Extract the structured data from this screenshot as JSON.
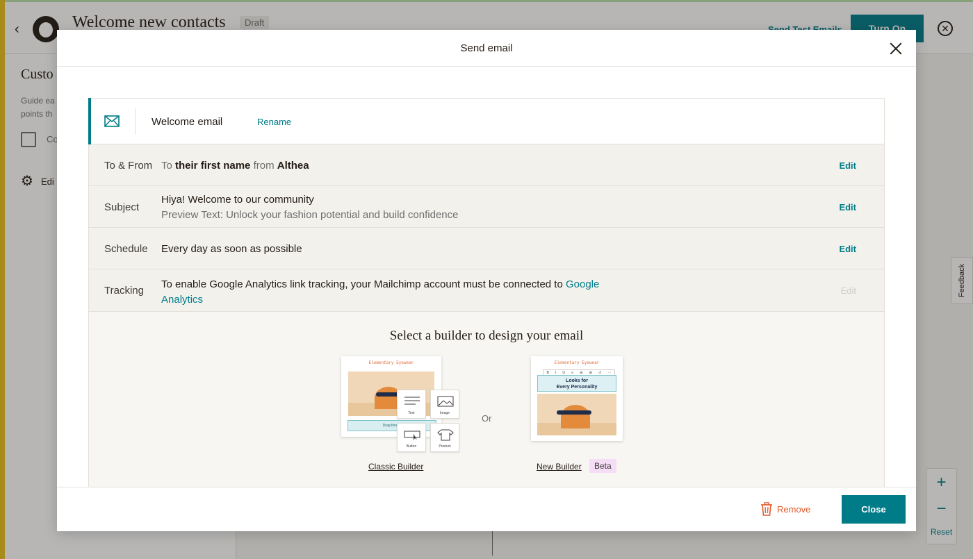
{
  "background": {
    "title": "Welcome new contacts",
    "status_badge": "Draft",
    "send_test_label": "Send Test Emails",
    "turn_on_label": "Turn On",
    "sidebar_title": "Custo",
    "sidebar_desc_1": "Guide ea",
    "sidebar_desc_2": "points th",
    "sidebar_check_label": "Co",
    "sidebar_edit_label": "Edi",
    "feedback_label": "Feedback",
    "zoom_plus": "+",
    "zoom_minus": "−",
    "zoom_reset": "Reset"
  },
  "modal": {
    "title": "Send email",
    "email_name": "Welcome email",
    "rename_label": "Rename",
    "rows": {
      "to_from": {
        "label": "To & From",
        "to_prefix": "To",
        "to_value": "their first name",
        "from_prefix": "from",
        "from_value": "Althea",
        "edit_label": "Edit"
      },
      "subject": {
        "label": "Subject",
        "value": "Hiya! Welcome to our community",
        "preview_text": "Preview Text: Unlock your fashion potential and build confidence",
        "edit_label": "Edit"
      },
      "schedule": {
        "label": "Schedule",
        "value": "Every day as soon as possible",
        "edit_label": "Edit"
      },
      "tracking": {
        "label": "Tracking",
        "text": "To enable Google Analytics link tracking, your Mailchimp account must be connected to",
        "link_line1": "Google",
        "link_line2": "Analytics",
        "edit_label": "Edit"
      }
    },
    "builder": {
      "title": "Select a builder to design your email",
      "or_label": "Or",
      "classic": {
        "brand": "Elementary Eyewear",
        "band_text": "Drag blocks",
        "tiles": [
          "Text",
          "Image",
          "Button",
          "Product"
        ],
        "link_label": "Classic Builder"
      },
      "new": {
        "brand": "Elementary Eyewear",
        "toolbar": [
          "B",
          "I",
          "U",
          "≡",
          "☰",
          "☰",
          "↺",
          "⋯"
        ],
        "headline_1": "Looks for",
        "headline_2": "Every Personality",
        "link_label": "New Builder",
        "badge": "Beta"
      }
    },
    "footer": {
      "remove_label": "Remove",
      "close_label": "Close"
    }
  },
  "colors": {
    "accent": "#007c89",
    "remove": "#e05a2b",
    "beta_badge": "#f5ddf5"
  }
}
